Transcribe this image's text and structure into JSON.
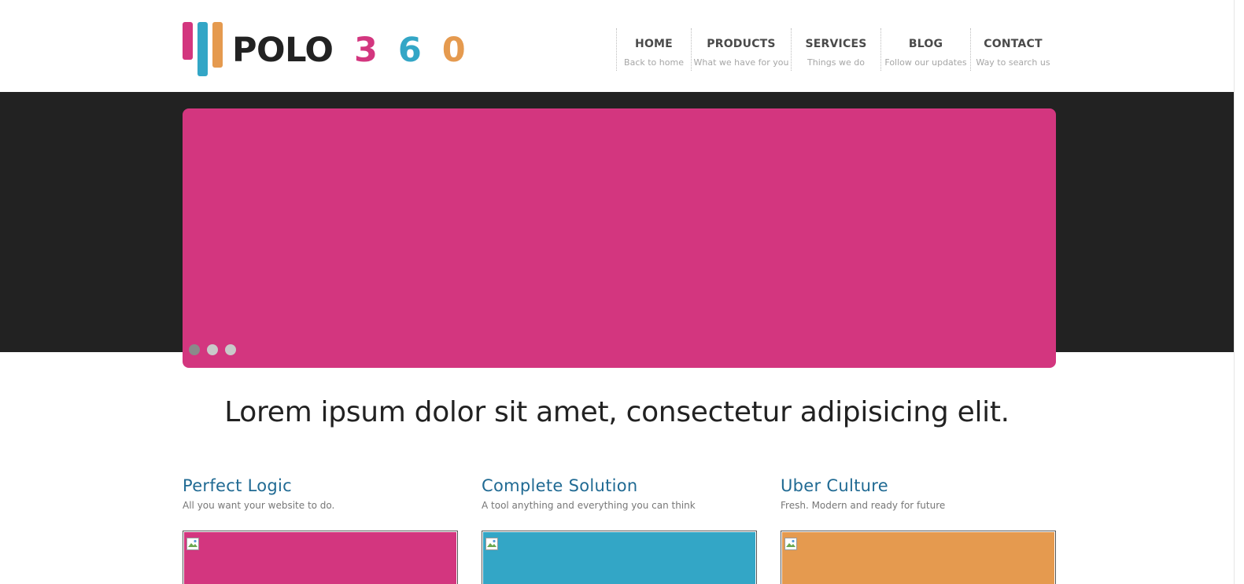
{
  "colors": {
    "pink": "#d3367f",
    "blue": "#33a6c6",
    "orange": "#e59a4f",
    "dark": "#222222",
    "title_blue": "#206a93"
  },
  "logo": {
    "word": "POLO",
    "digit1": "3",
    "digit2": "6",
    "digit3": "0"
  },
  "nav": [
    {
      "label": "HOME",
      "sub": "Back to home"
    },
    {
      "label": "PRODUCTS",
      "sub": "What we have for you"
    },
    {
      "label": "SERVICES",
      "sub": "Things we do"
    },
    {
      "label": "BLOG",
      "sub": "Follow our updates"
    },
    {
      "label": "CONTACT",
      "sub": "Way to search us"
    }
  ],
  "slider": {
    "slide_color": "#d3367f",
    "dots": 3,
    "active_dot": 1
  },
  "tagline": "Lorem ipsum dolor sit amet, consectetur adipisicing elit.",
  "features": [
    {
      "title": "Perfect Logic",
      "subtitle": "All you want your website to do.",
      "color": "#d3367f",
      "icon": "broken-image-icon"
    },
    {
      "title": "Complete Solution",
      "subtitle": "A tool anything and everything you can think",
      "color": "#33a6c6",
      "icon": "broken-image-icon"
    },
    {
      "title": "Uber Culture",
      "subtitle": "Fresh. Modern and ready for future",
      "color": "#e59a4f",
      "icon": "broken-image-icon"
    }
  ]
}
